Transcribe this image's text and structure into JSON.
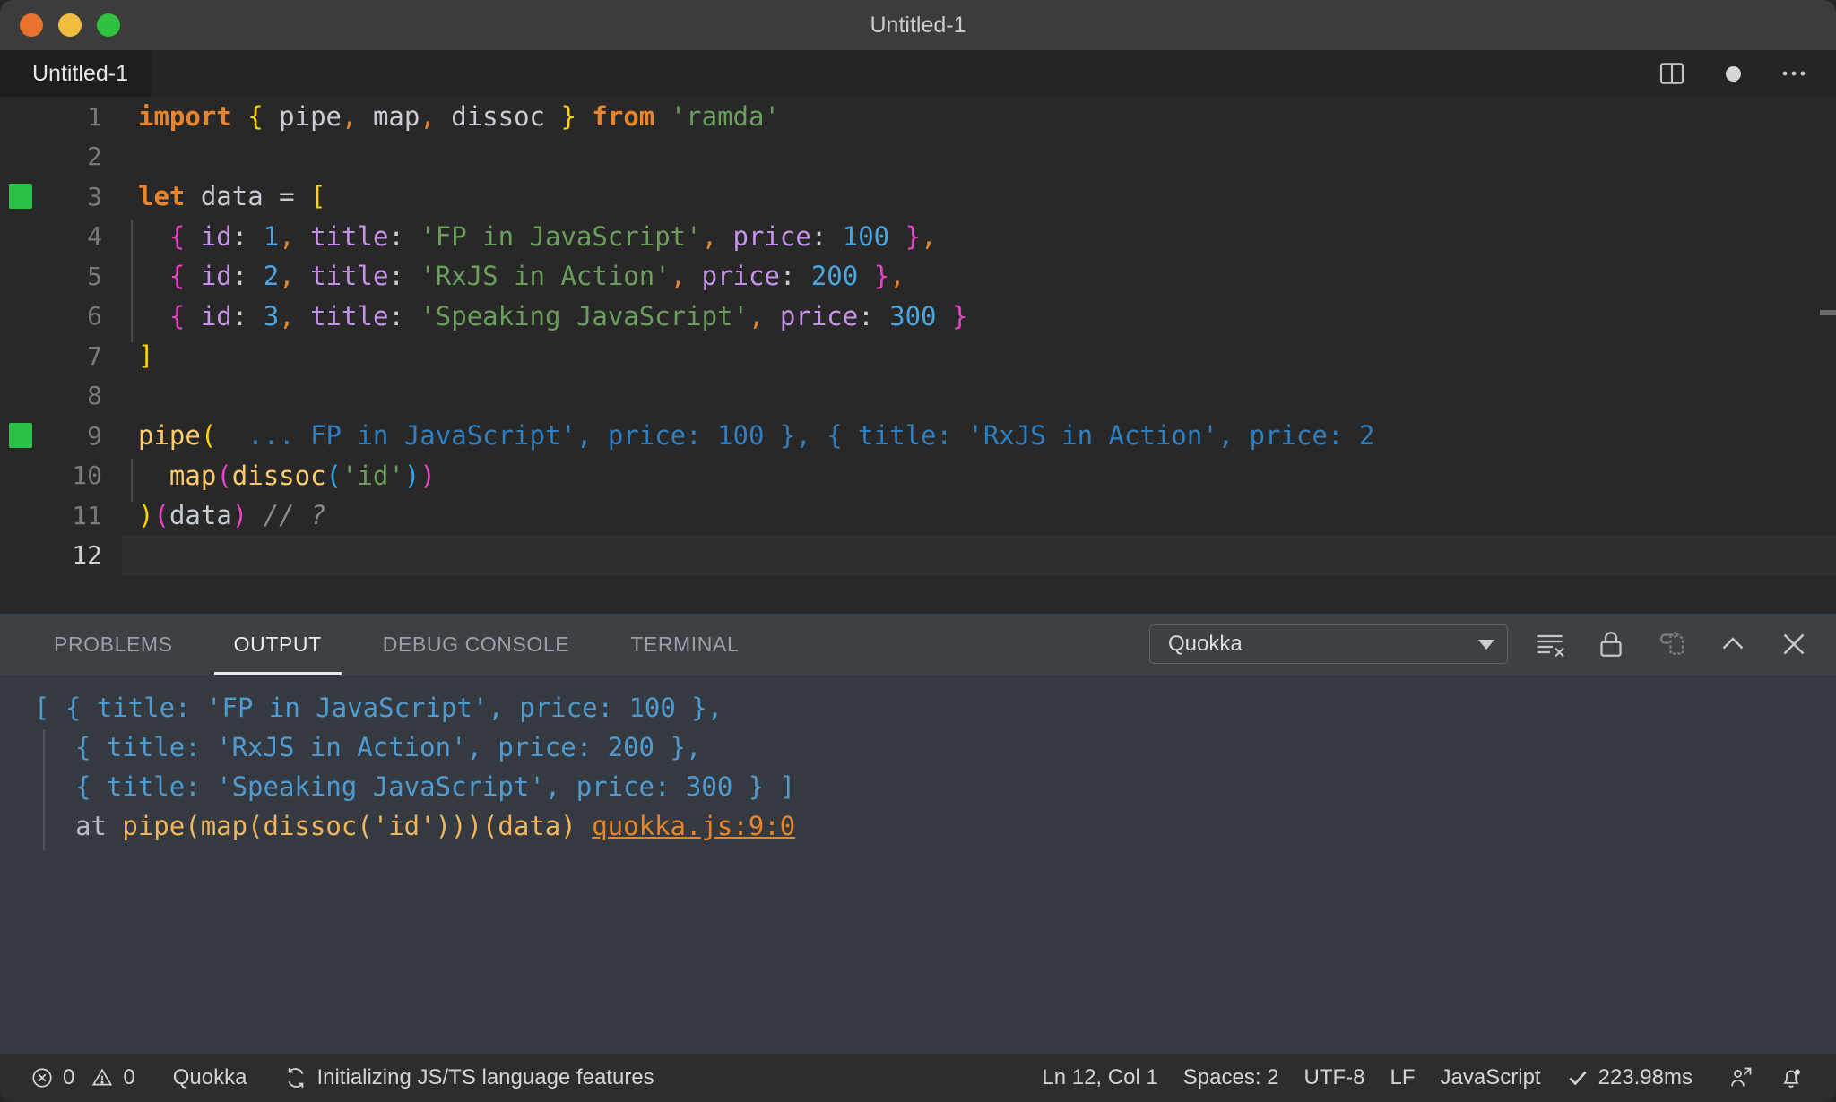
{
  "window": {
    "title": "Untitled-1",
    "traffic_lights": [
      "close-red",
      "minimize-yellow",
      "maximize-green"
    ]
  },
  "editor_tab": {
    "label": "Untitled-1",
    "actions": [
      "split-editor-icon",
      "unsaved-dot-icon",
      "more-actions-icon"
    ]
  },
  "code": {
    "language": "JavaScript",
    "lines": [
      {
        "n": "1",
        "run": false
      },
      {
        "n": "2",
        "run": false
      },
      {
        "n": "3",
        "run": true
      },
      {
        "n": "4",
        "run": false
      },
      {
        "n": "5",
        "run": false
      },
      {
        "n": "6",
        "run": false
      },
      {
        "n": "7",
        "run": false
      },
      {
        "n": "8",
        "run": false
      },
      {
        "n": "9",
        "run": true
      },
      {
        "n": "10",
        "run": false
      },
      {
        "n": "11",
        "run": false
      },
      {
        "n": "12",
        "run": false
      }
    ],
    "text": {
      "l1_import": "import",
      "l1_brace_open": "{",
      "l1_pipe": " pipe",
      "l1_comma1": ",",
      "l1_map": " map",
      "l1_comma2": ",",
      "l1_dissoc": " dissoc ",
      "l1_brace_close": "}",
      "l1_from": " from ",
      "l1_ramda": "'ramda'",
      "l3_let": "let",
      "l3_data": " data ",
      "l3_eq": "= ",
      "l3_bracket": "[",
      "l4_open": "{",
      "l4_id": " id",
      "l4_colon1": ": ",
      "l4_idval": "1",
      "l4_comma1": ",",
      "l4_title": " title",
      "l4_colon2": ": ",
      "l4_titleval": "'FP in JavaScript'",
      "l4_comma2": ",",
      "l4_price": " price",
      "l4_colon3": ": ",
      "l4_priceval": "100",
      "l4_close": " }",
      "l4_trail": ",",
      "l5_open": "{",
      "l5_id": " id",
      "l5_colon1": ": ",
      "l5_idval": "2",
      "l5_comma1": ",",
      "l5_title": " title",
      "l5_colon2": ": ",
      "l5_titleval": "'RxJS in Action'",
      "l5_comma2": ",",
      "l5_price": " price",
      "l5_colon3": ": ",
      "l5_priceval": "200",
      "l5_close": " }",
      "l5_trail": ",",
      "l6_open": "{",
      "l6_id": " id",
      "l6_colon1": ": ",
      "l6_idval": "3",
      "l6_comma1": ",",
      "l6_title": " title",
      "l6_colon2": ": ",
      "l6_titleval": "'Speaking JavaScript'",
      "l6_comma2": ",",
      "l6_price": " price",
      "l6_colon3": ": ",
      "l6_priceval": "300",
      "l6_close": " }",
      "l7_bracket": "]",
      "l9_pipe": "pipe",
      "l9_paren": "(",
      "l9_dots": "  ...",
      "l9_annotation": " FP in JavaScript', price: 100 }, { title: 'RxJS in Action', price: 2",
      "l10_map": "map",
      "l10_paren_open": "(",
      "l10_dissoc": "dissoc",
      "l10_paren2_open": "(",
      "l10_id": "'id'",
      "l10_paren2_close": ")",
      "l10_paren_close": ")",
      "l11_paren_close": ")",
      "l11_data_open": "(",
      "l11_data": "data",
      "l11_data_close": ")",
      "l11_comment": " // ?"
    }
  },
  "panel": {
    "tabs": [
      {
        "label": "PROBLEMS",
        "active": false
      },
      {
        "label": "OUTPUT",
        "active": true
      },
      {
        "label": "DEBUG CONSOLE",
        "active": false
      },
      {
        "label": "TERMINAL",
        "active": false
      }
    ],
    "channel_select": {
      "value": "Quokka",
      "icon": "chevron-down-icon"
    },
    "icons": [
      "clear-output-icon",
      "lock-scroll-icon",
      "open-in-editor-icon",
      "maximize-panel-icon",
      "close-panel-icon"
    ],
    "output": {
      "line1_bracket": "[ ",
      "line1_body": "{ title: 'FP in JavaScript', price: 100 },",
      "line2_body": "{ title: 'RxJS in Action', price: 200 },",
      "line3_body": "{ title: 'Speaking JavaScript', price: 300 } ]",
      "line4_at": "at ",
      "line4_call": "pipe(map(dissoc('id')))(data) ",
      "line4_link": "quokka.js:9:0"
    }
  },
  "statusbar": {
    "errors": "0",
    "warnings": "0",
    "quokka": "Quokka",
    "task": "Initializing JS/TS language features",
    "cursor": "Ln 12, Col 1",
    "indent": "Spaces: 2",
    "encoding": "UTF-8",
    "eol": "LF",
    "language": "JavaScript",
    "runtime": "223.98ms",
    "icons": [
      "error-icon",
      "warning-icon",
      "sync-icon",
      "check-icon",
      "remote-account-icon",
      "bell-icon"
    ]
  },
  "colors": {
    "editor_bg": "#282828",
    "panel_bg": "#343a3f",
    "status_bg": "#2d2d2d",
    "accent_green": "#2ec14a",
    "accent_orange": "#e8852a",
    "inline_blue": "#2f7fc0",
    "output_blue": "#4f9bd1"
  }
}
